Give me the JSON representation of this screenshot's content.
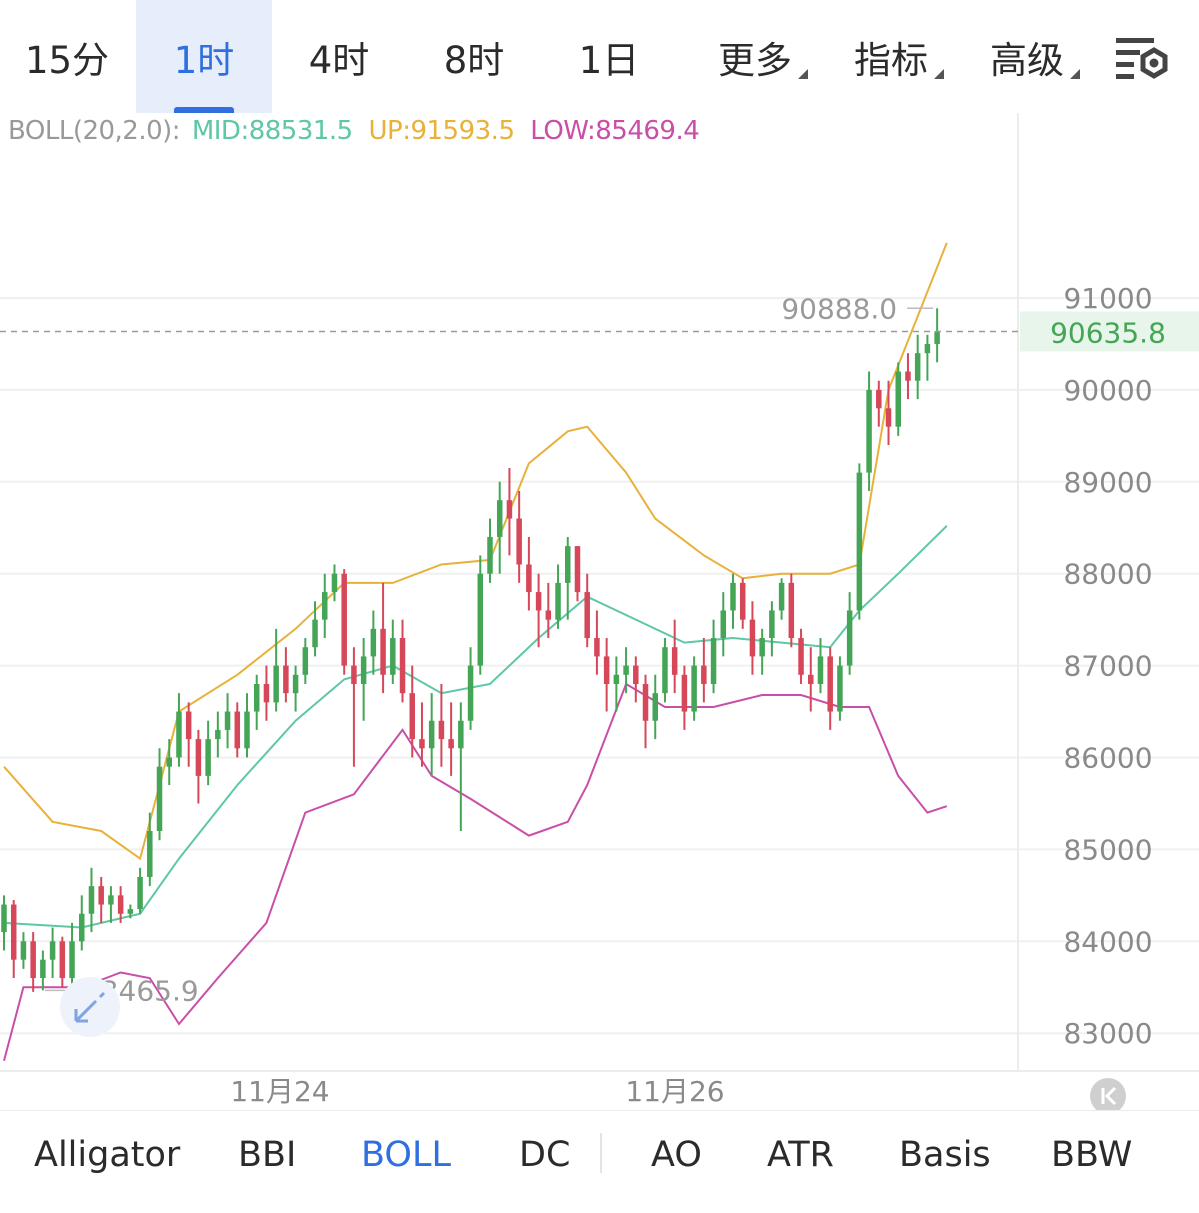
{
  "timeframes": [
    {
      "label": "15分",
      "active": false
    },
    {
      "label": "1时",
      "active": true
    },
    {
      "label": "4时",
      "active": false
    },
    {
      "label": "8时",
      "active": false
    },
    {
      "label": "1日",
      "active": false
    },
    {
      "label": "更多",
      "active": false,
      "dropdown": true
    },
    {
      "label": "指标",
      "active": false,
      "dropdown": true
    },
    {
      "label": "高级",
      "active": false,
      "dropdown": true
    }
  ],
  "settings_icon": "chart-settings-icon",
  "legend": {
    "name": "BOLL(20,2.0):",
    "mid": "MID:88531.5",
    "up": "UP:91593.5",
    "low": "LOW:85469.4"
  },
  "colors": {
    "mid": "#5ec7a5",
    "up": "#e8b13a",
    "low": "#c94ea8",
    "bull": "#45a557",
    "bear": "#d6475a",
    "accent": "#2f6fe0"
  },
  "price_labels": {
    "high_marker": "90888.0",
    "low_marker": "83465.9",
    "last_price": "90635.8"
  },
  "chart_data": {
    "type": "candlestick",
    "title": "",
    "y_axis_ticks": [
      "91000",
      "90000",
      "89000",
      "88000",
      "87000",
      "86000",
      "85000",
      "84000",
      "83000"
    ],
    "x_axis_labels": [
      "11月24",
      "11月26"
    ],
    "ylim": [
      82500,
      92300
    ],
    "last_price": 90635.8,
    "highest": 90888.0,
    "lowest": 83465.9,
    "candles": [
      [
        84100,
        84500,
        83900,
        84400
      ],
      [
        84400,
        84450,
        83600,
        83800
      ],
      [
        83800,
        84100,
        83700,
        84000
      ],
      [
        84000,
        84100,
        83450,
        83600
      ],
      [
        83600,
        83900,
        83466,
        83800
      ],
      [
        83800,
        84150,
        83600,
        84000
      ],
      [
        84000,
        84050,
        83500,
        83600
      ],
      [
        83600,
        84200,
        83500,
        84000
      ],
      [
        84000,
        84500,
        83900,
        84300
      ],
      [
        84300,
        84800,
        84100,
        84600
      ],
      [
        84600,
        84700,
        84200,
        84400
      ],
      [
        84400,
        84600,
        84200,
        84500
      ],
      [
        84500,
        84600,
        84200,
        84300
      ],
      [
        84300,
        84400,
        84250,
        84350
      ],
      [
        84350,
        84800,
        84300,
        84700
      ],
      [
        84700,
        85400,
        84600,
        85200
      ],
      [
        85200,
        86100,
        85100,
        85900
      ],
      [
        85900,
        86200,
        85700,
        86000
      ],
      [
        86000,
        86700,
        85900,
        86500
      ],
      [
        86500,
        86600,
        85900,
        86200
      ],
      [
        86200,
        86300,
        85500,
        85800
      ],
      [
        85800,
        86400,
        85700,
        86200
      ],
      [
        86200,
        86500,
        86000,
        86300
      ],
      [
        86300,
        86700,
        86100,
        86500
      ],
      [
        86500,
        86600,
        86000,
        86100
      ],
      [
        86100,
        86700,
        86000,
        86500
      ],
      [
        86500,
        86900,
        86300,
        86800
      ],
      [
        86800,
        87000,
        86400,
        86600
      ],
      [
        86600,
        87400,
        86500,
        87000
      ],
      [
        87000,
        87200,
        86600,
        86700
      ],
      [
        86700,
        87000,
        86500,
        86900
      ],
      [
        86900,
        87300,
        86800,
        87200
      ],
      [
        87200,
        87700,
        87100,
        87500
      ],
      [
        87500,
        88000,
        87300,
        87800
      ],
      [
        87800,
        88100,
        87700,
        88000
      ],
      [
        88000,
        88050,
        86900,
        87000
      ],
      [
        87000,
        87200,
        85900,
        86800
      ],
      [
        86800,
        87300,
        86400,
        87100
      ],
      [
        87100,
        87600,
        86900,
        87400
      ],
      [
        87400,
        87900,
        86700,
        86900
      ],
      [
        86900,
        87500,
        86800,
        87300
      ],
      [
        87300,
        87500,
        86600,
        86700
      ],
      [
        86700,
        87000,
        86000,
        86200
      ],
      [
        86200,
        86600,
        85900,
        86100
      ],
      [
        86100,
        86700,
        85800,
        86400
      ],
      [
        86400,
        86800,
        85900,
        86200
      ],
      [
        86200,
        86600,
        85800,
        86100
      ],
      [
        86100,
        86600,
        85200,
        86400
      ],
      [
        86400,
        87200,
        86300,
        87000
      ],
      [
        87000,
        88200,
        86900,
        88000
      ],
      [
        88000,
        88600,
        87900,
        88400
      ],
      [
        88400,
        89000,
        88000,
        88800
      ],
      [
        88800,
        89150,
        88200,
        88600
      ],
      [
        88600,
        88900,
        87900,
        88100
      ],
      [
        88100,
        88400,
        87600,
        87800
      ],
      [
        87800,
        88000,
        87200,
        87600
      ],
      [
        87600,
        87900,
        87300,
        87500
      ],
      [
        87500,
        88100,
        87400,
        87900
      ],
      [
        87900,
        88400,
        87500,
        88300
      ],
      [
        88300,
        88300,
        87700,
        87800
      ],
      [
        87800,
        88000,
        87200,
        87300
      ],
      [
        87300,
        87600,
        86900,
        87100
      ],
      [
        87100,
        87300,
        86500,
        86800
      ],
      [
        86800,
        87100,
        86500,
        86900
      ],
      [
        86900,
        87200,
        86700,
        87000
      ],
      [
        87000,
        87100,
        86600,
        86800
      ],
      [
        86800,
        86900,
        86100,
        86400
      ],
      [
        86400,
        86900,
        86200,
        86700
      ],
      [
        86700,
        87300,
        86600,
        87200
      ],
      [
        87200,
        87500,
        86700,
        86900
      ],
      [
        86900,
        87000,
        86300,
        86500
      ],
      [
        86500,
        87100,
        86400,
        87000
      ],
      [
        87000,
        87300,
        86600,
        86800
      ],
      [
        86800,
        87500,
        86700,
        87300
      ],
      [
        87300,
        87800,
        87100,
        87600
      ],
      [
        87600,
        88000,
        87400,
        87900
      ],
      [
        87900,
        87950,
        87400,
        87500
      ],
      [
        87500,
        87700,
        86900,
        87100
      ],
      [
        87100,
        87400,
        86900,
        87300
      ],
      [
        87300,
        87700,
        87100,
        87600
      ],
      [
        87600,
        87950,
        87500,
        87900
      ],
      [
        87900,
        88000,
        87200,
        87300
      ],
      [
        87300,
        87400,
        86800,
        86900
      ],
      [
        86900,
        87200,
        86500,
        86800
      ],
      [
        86800,
        87300,
        86700,
        87100
      ],
      [
        87100,
        87200,
        86300,
        86500
      ],
      [
        86500,
        87100,
        86400,
        87000
      ],
      [
        87000,
        87800,
        86900,
        87600
      ],
      [
        87600,
        89200,
        87500,
        89100
      ],
      [
        89100,
        90200,
        88900,
        90000
      ],
      [
        90000,
        90100,
        89600,
        89800
      ],
      [
        89800,
        90100,
        89400,
        89600
      ],
      [
        89600,
        90300,
        89500,
        90200
      ],
      [
        90200,
        90400,
        89900,
        90100
      ],
      [
        90100,
        90600,
        89900,
        90400
      ],
      [
        90400,
        90600,
        90100,
        90500
      ],
      [
        90500,
        90888,
        90300,
        90636
      ]
    ],
    "series": [
      {
        "name": "MID",
        "points": [
          [
            0,
            84200
          ],
          [
            8,
            84150
          ],
          [
            14,
            84300
          ],
          [
            18,
            84900
          ],
          [
            24,
            85700
          ],
          [
            30,
            86400
          ],
          [
            35,
            86850
          ],
          [
            40,
            87000
          ],
          [
            45,
            86700
          ],
          [
            50,
            86800
          ],
          [
            55,
            87300
          ],
          [
            60,
            87750
          ],
          [
            65,
            87500
          ],
          [
            70,
            87250
          ],
          [
            75,
            87300
          ],
          [
            80,
            87250
          ],
          [
            85,
            87200
          ],
          [
            88,
            87600
          ],
          [
            92,
            88000
          ],
          [
            97,
            88520
          ]
        ]
      },
      {
        "name": "UP",
        "points": [
          [
            0,
            85900
          ],
          [
            5,
            85300
          ],
          [
            10,
            85200
          ],
          [
            14,
            84900
          ],
          [
            18,
            86500
          ],
          [
            24,
            86900
          ],
          [
            30,
            87400
          ],
          [
            35,
            87900
          ],
          [
            40,
            87900
          ],
          [
            45,
            88100
          ],
          [
            50,
            88150
          ],
          [
            54,
            89200
          ],
          [
            58,
            89550
          ],
          [
            60,
            89600
          ],
          [
            64,
            89100
          ],
          [
            67,
            88600
          ],
          [
            72,
            88200
          ],
          [
            76,
            87950
          ],
          [
            80,
            88000
          ],
          [
            85,
            88000
          ],
          [
            88,
            88100
          ],
          [
            91,
            90000
          ],
          [
            97,
            91600
          ]
        ]
      },
      {
        "name": "LOW",
        "points": [
          [
            0,
            82700
          ],
          [
            2,
            83500
          ],
          [
            4,
            83500
          ],
          [
            8,
            83500
          ],
          [
            12,
            83660
          ],
          [
            15,
            83600
          ],
          [
            18,
            83100
          ],
          [
            22,
            83600
          ],
          [
            27,
            84200
          ],
          [
            31,
            85400
          ],
          [
            36,
            85600
          ],
          [
            41,
            86300
          ],
          [
            44,
            85800
          ],
          [
            48,
            85550
          ],
          [
            54,
            85150
          ],
          [
            58,
            85300
          ],
          [
            60,
            85700
          ],
          [
            64,
            86800
          ],
          [
            68,
            86550
          ],
          [
            73,
            86550
          ],
          [
            78,
            86680
          ],
          [
            82,
            86680
          ],
          [
            86,
            86550
          ],
          [
            89,
            86550
          ],
          [
            92,
            85800
          ],
          [
            95,
            85400
          ],
          [
            97,
            85470
          ]
        ]
      }
    ],
    "grid": true,
    "legend_placement": "top-left"
  },
  "indicators": [
    {
      "label": "Alligator",
      "active": false
    },
    {
      "label": "BBI",
      "active": false
    },
    {
      "label": "BOLL",
      "active": true
    },
    {
      "label": "DC",
      "active": false
    },
    {
      "label": "AO",
      "active": false
    },
    {
      "label": "ATR",
      "active": false
    },
    {
      "label": "Basis",
      "active": false
    },
    {
      "label": "BBW",
      "active": false
    }
  ]
}
